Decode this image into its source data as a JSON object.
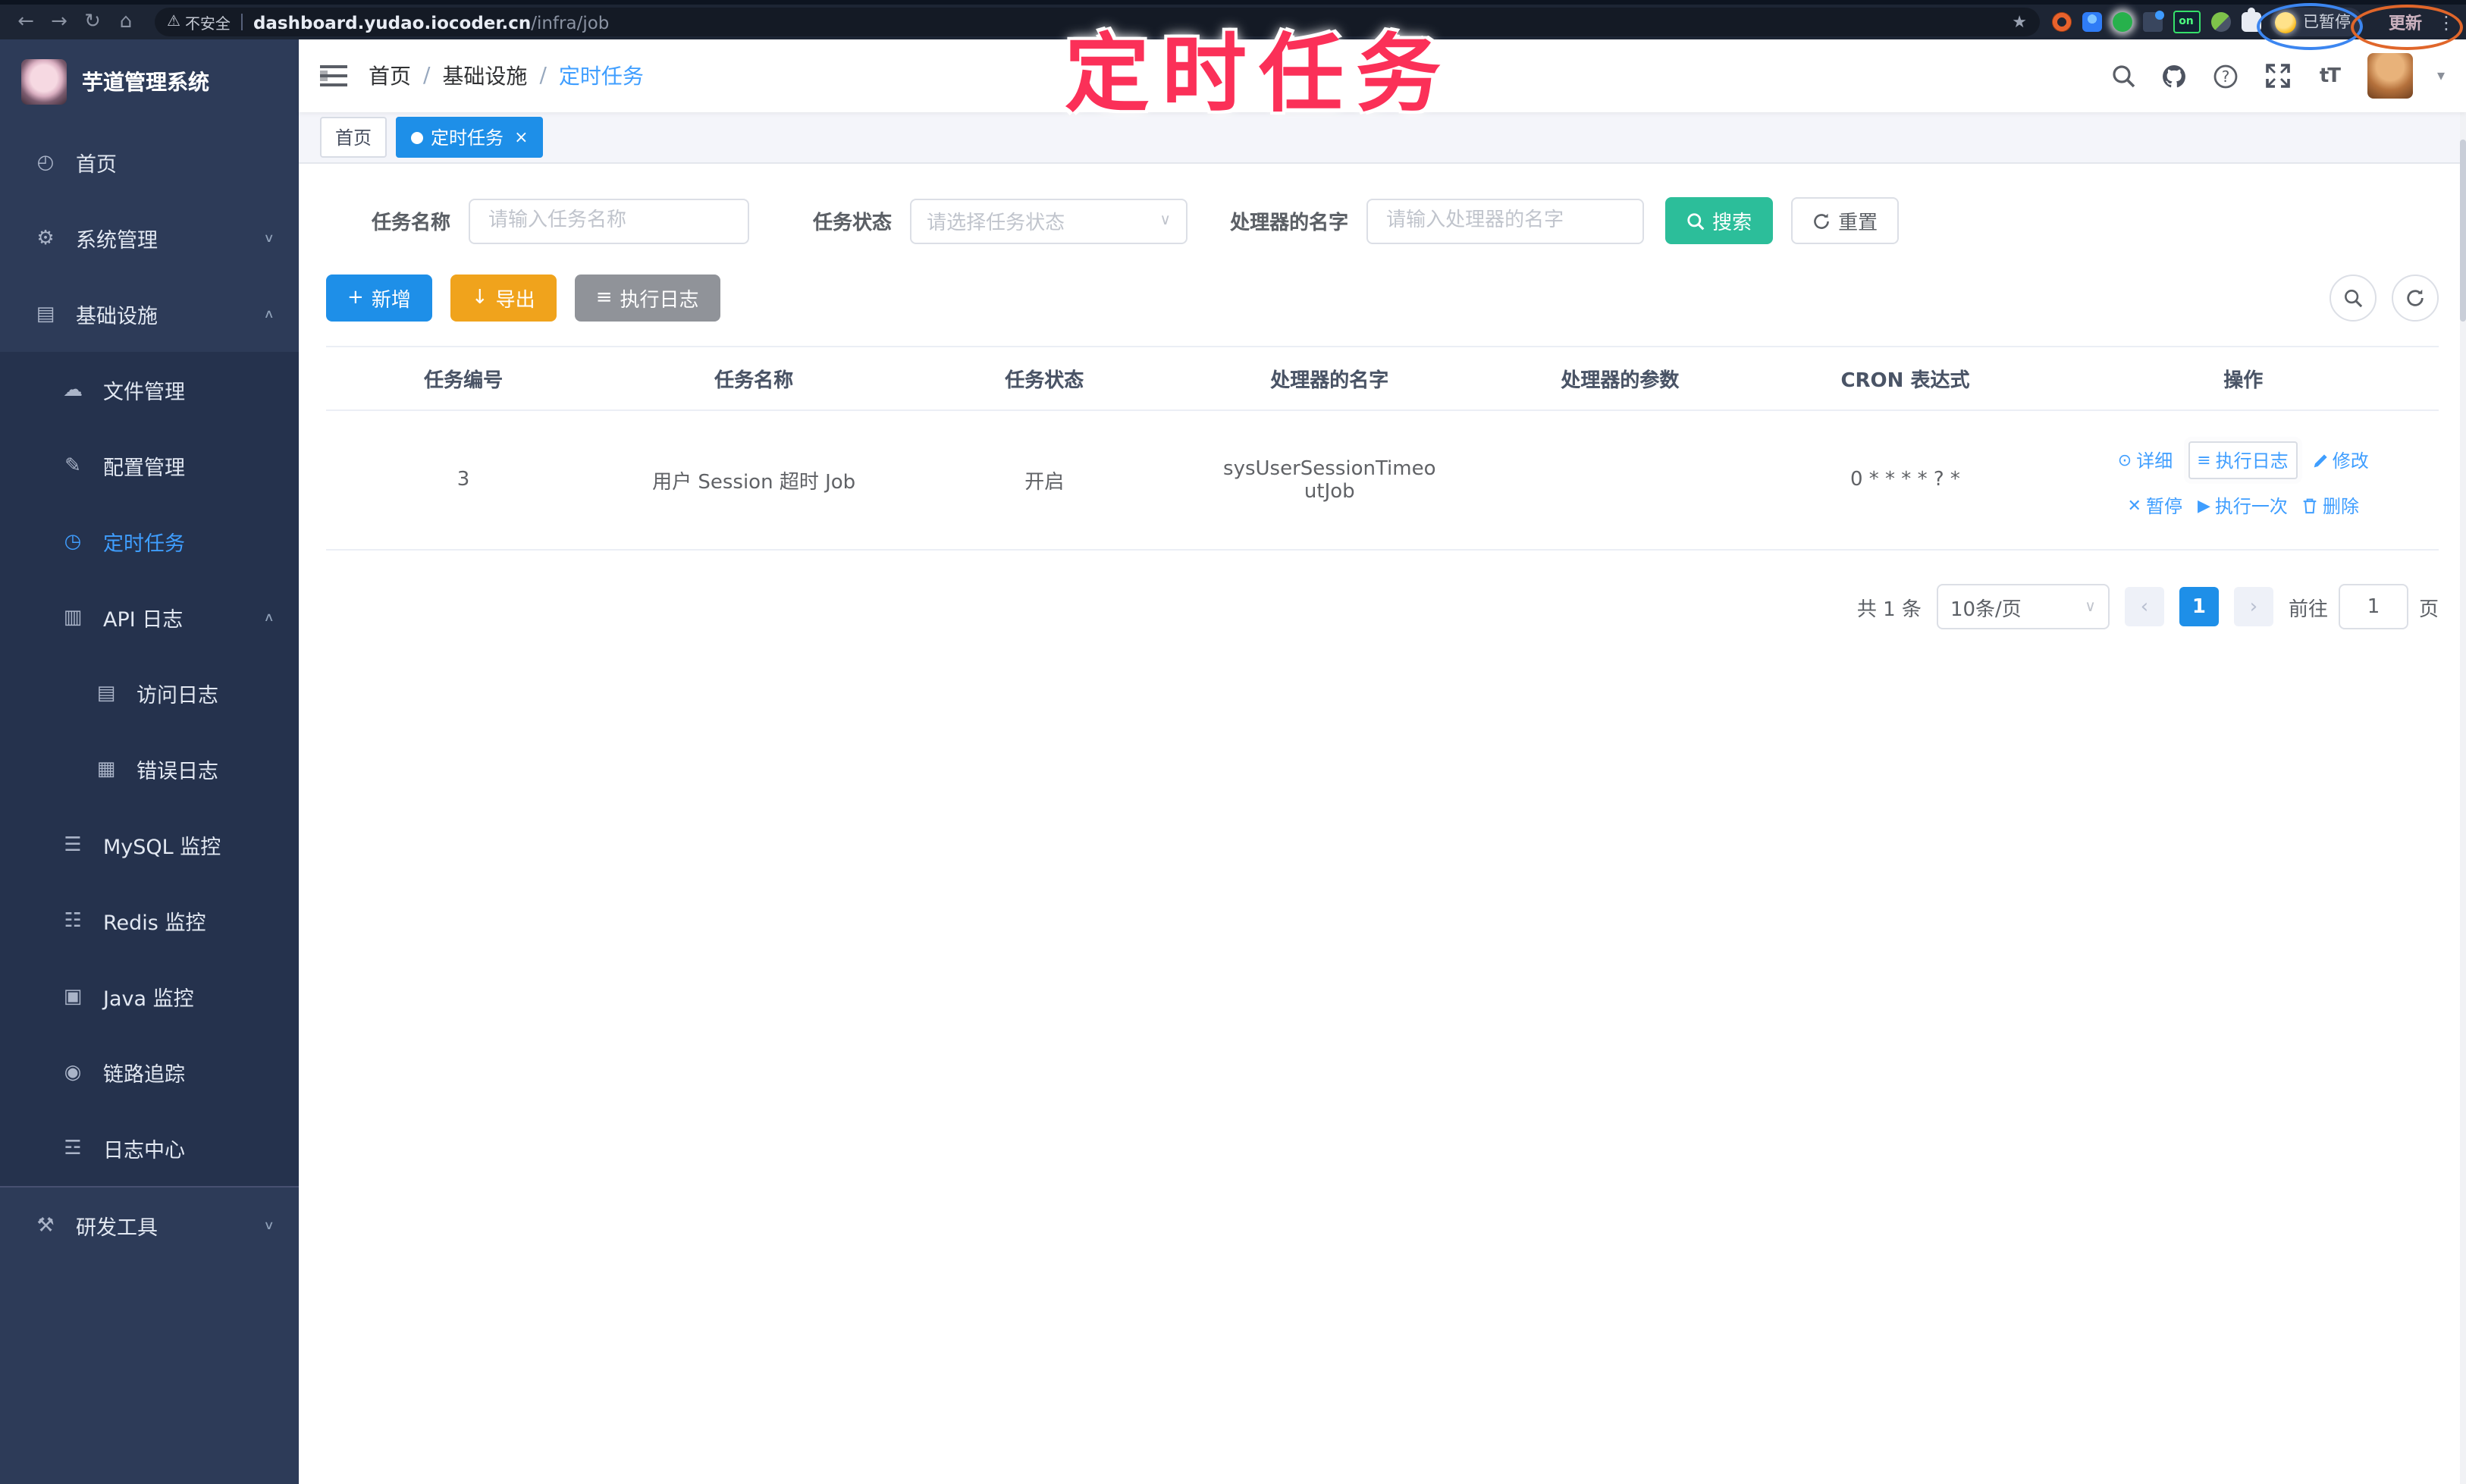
{
  "colors": {
    "primary": "#1e8fe8",
    "link": "#3f9eff",
    "success": "#2cbe9a",
    "warning": "#f0a31c",
    "info": "#909399",
    "sidebar_bg": "#2d3b58",
    "sidebar_submenu_bg": "#25324d",
    "annotation_pink": "#fb3058",
    "active_text": "#3f9eff"
  },
  "annotation": {
    "text": "定时任务"
  },
  "browser": {
    "security_label": "不安全",
    "url_host": "dashboard.yudao.iocoder.cn",
    "url_path": "/infra/job",
    "extension_on_badge": "on",
    "paused_label": "已暂停",
    "update_label": "更新",
    "menu_dots": "⋮",
    "warning_glyph": "⚠",
    "back_glyph": "←",
    "forward_glyph": "→",
    "reload_glyph": "↻",
    "home_glyph": "⌂",
    "star_glyph": "★"
  },
  "sidebar": {
    "title": "芋道管理系统",
    "items": [
      {
        "label": "首页",
        "glyph": "◴",
        "chevron": ""
      },
      {
        "label": "系统管理",
        "glyph": "⚙",
        "chevron": "∨"
      },
      {
        "label": "基础设施",
        "glyph": "▤",
        "chevron": "∧"
      },
      {
        "label": "文件管理",
        "glyph": "☁",
        "chevron": ""
      },
      {
        "label": "配置管理",
        "glyph": "✎",
        "chevron": ""
      },
      {
        "label": "定时任务",
        "glyph": "◷",
        "chevron": ""
      },
      {
        "label": "API 日志",
        "glyph": "▥",
        "chevron": "∧"
      },
      {
        "label": "访问日志",
        "glyph": "▤",
        "chevron": ""
      },
      {
        "label": "错误日志",
        "glyph": "▦",
        "chevron": ""
      },
      {
        "label": "MySQL 监控",
        "glyph": "☰",
        "chevron": ""
      },
      {
        "label": "Redis 监控",
        "glyph": "☷",
        "chevron": ""
      },
      {
        "label": "Java 监控",
        "glyph": "▣",
        "chevron": ""
      },
      {
        "label": "链路追踪",
        "glyph": "◉",
        "chevron": ""
      },
      {
        "label": "日志中心",
        "glyph": "☲",
        "chevron": ""
      },
      {
        "label": "研发工具",
        "glyph": "⚒",
        "chevron": "∨"
      }
    ]
  },
  "topbar": {
    "breadcrumb": [
      "首页",
      "基础设施",
      "定时任务"
    ],
    "separator": "/"
  },
  "tags": {
    "home": "首页",
    "active": "定时任务",
    "close_glyph": "×"
  },
  "filters": {
    "name_label": "任务名称",
    "name_placeholder": "请输入任务名称",
    "status_label": "任务状态",
    "status_placeholder": "请选择任务状态",
    "handler_label": "处理器的名字",
    "handler_placeholder": "请输入处理器的名字",
    "search_label": "搜索",
    "reset_label": "重置"
  },
  "toolbar": {
    "add_label": "新增",
    "export_label": "导出",
    "job_log_label": "执行日志",
    "add_glyph": "+",
    "export_glyph": "↓",
    "job_log_glyph": "≡"
  },
  "table": {
    "columns": [
      "任务编号",
      "任务名称",
      "任务状态",
      "处理器的名字",
      "处理器的参数",
      "CRON 表达式",
      "操作"
    ],
    "rows": [
      {
        "id": "3",
        "name": "用户 Session 超时 Job",
        "status": "开启",
        "handler": "sysUserSessionTimeoutJob",
        "param": "",
        "cron": "0 * * * * ? *"
      }
    ],
    "ops": {
      "detail": "详细",
      "log": "执行日志",
      "edit": "修改",
      "pause": "暂停",
      "run_once": "执行一次",
      "delete": "删除",
      "detail_glyph": "⊙",
      "log_glyph": "≡",
      "pause_glyph": "✕",
      "run_once_glyph": "▶"
    }
  },
  "pagination": {
    "total": "共 1 条",
    "page_size": "10条/页",
    "prev_glyph": "‹",
    "page": "1",
    "next_glyph": "›",
    "goto_label": "前往",
    "goto_value": "1",
    "goto_suffix": "页"
  }
}
